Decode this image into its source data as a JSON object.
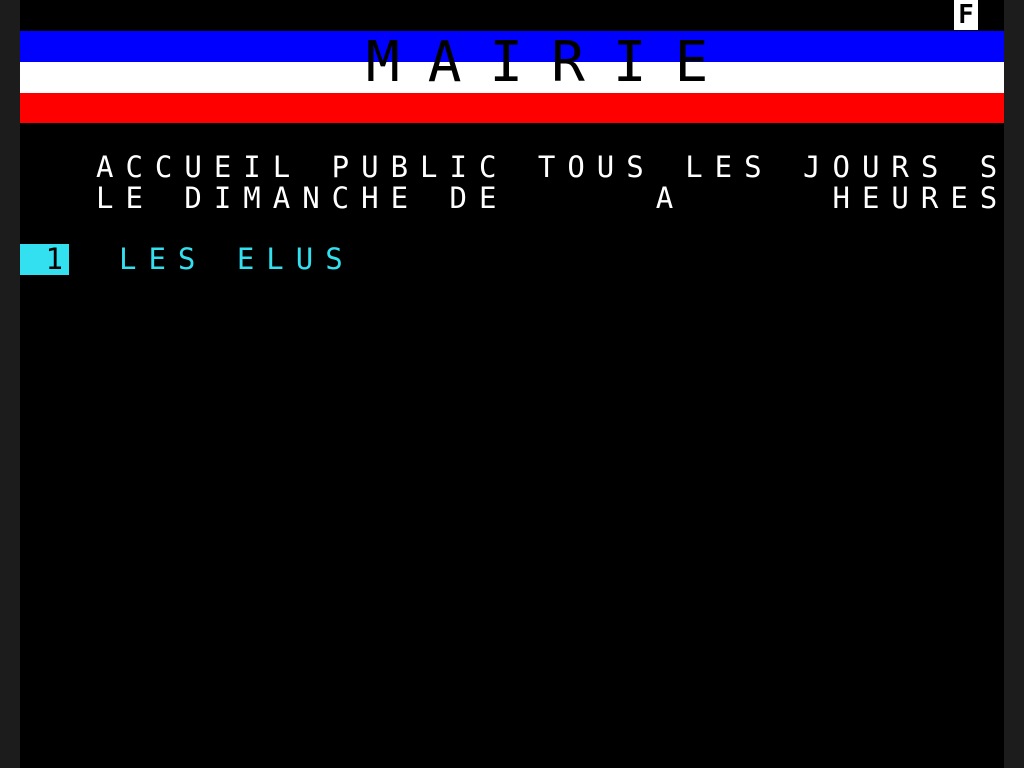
{
  "header": {
    "language_badge": "F",
    "title": "MAIRIE"
  },
  "info": {
    "line1": "ACCUEIL PUBLIC TOUS LES JOURS SAUF",
    "line2": "LE DIMANCHE DE     A     HEURES"
  },
  "menu": {
    "items": [
      {
        "number": "1",
        "label": "LES ELUS"
      }
    ]
  },
  "colors": {
    "background": "#000000",
    "flag_blue": "#0000ff",
    "flag_white": "#ffffff",
    "flag_red": "#ff0000",
    "menu_accent": "#33e0f0",
    "text": "#ffffff"
  }
}
